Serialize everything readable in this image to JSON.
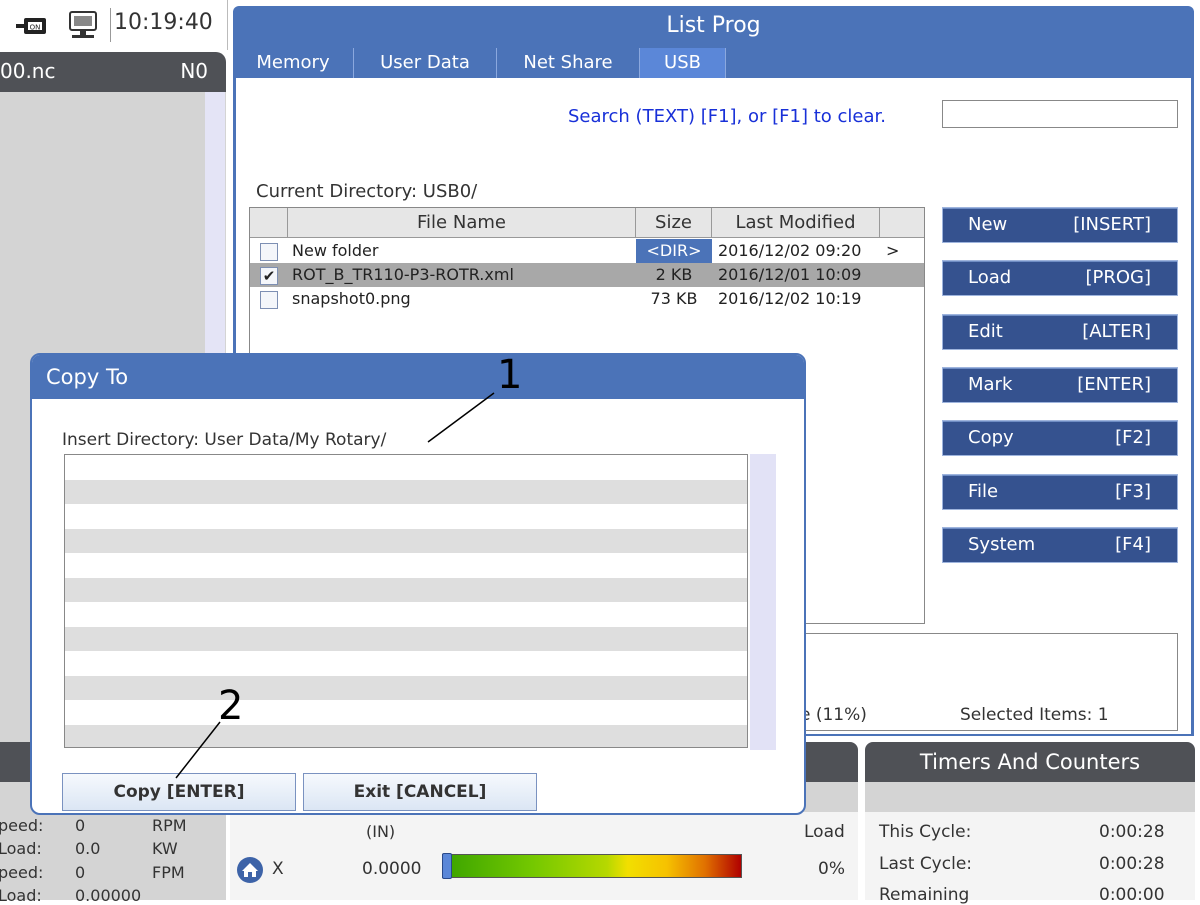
{
  "status": {
    "clock": "10:19:40"
  },
  "program_panel": {
    "filename": "00.nc",
    "n_code": "N0"
  },
  "list_prog": {
    "title": "List Prog",
    "tabs": [
      "Memory",
      "User Data",
      "Net Share",
      "USB"
    ],
    "active_tab": "USB",
    "search_hint": "Search (TEXT) [F1], or [F1] to clear.",
    "search_value": "",
    "current_directory": "Current Directory: USB0/",
    "columns": [
      "File Name",
      "Size",
      "Last Modified"
    ],
    "files": [
      {
        "checked": false,
        "name": "New folder",
        "size": "<DIR>",
        "modified": "2016/12/02 09:20",
        "arrow": ">"
      },
      {
        "checked": true,
        "name": "ROT_B_TR110-P3-ROTR.xml",
        "size": "2 KB",
        "modified": "2016/12/01 10:09",
        "arrow": ""
      },
      {
        "checked": false,
        "name": "snapshot0.png",
        "size": "73 KB",
        "modified": "2016/12/02 10:19",
        "arrow": ""
      }
    ],
    "buttons": [
      {
        "label": "New",
        "key": "[INSERT]"
      },
      {
        "label": "Load",
        "key": "[PROG]"
      },
      {
        "label": "Edit",
        "key": "[ALTER]"
      },
      {
        "label": "Mark",
        "key": "[ENTER]"
      },
      {
        "label": "Copy",
        "key": "[F2]"
      },
      {
        "label": "File",
        "key": "[F3]"
      },
      {
        "label": "System",
        "key": "[F4]"
      }
    ],
    "usage_text": "e (11%)",
    "selected_items": "Selected Items: 1"
  },
  "dialog": {
    "title": "Copy To",
    "insert_directory": "Insert Directory: User Data/My Rotary/",
    "copy_button": "Copy [ENTER]",
    "exit_button": "Exit [CANCEL]"
  },
  "callouts": {
    "one": "1",
    "two": "2"
  },
  "spindle": [
    {
      "label": "peed:",
      "value": "0",
      "unit": "RPM"
    },
    {
      "label": "Load:",
      "value": "0.0",
      "unit": "KW"
    },
    {
      "label": "peed:",
      "value": "0",
      "unit": "FPM"
    },
    {
      "label": "Load:",
      "value": "0.00000",
      "unit": ""
    }
  ],
  "axis": {
    "units": "(IN)",
    "load_header": "Load",
    "name": "X",
    "position": "0.0000",
    "load": "0%",
    "load_fraction": 0.0
  },
  "timers": {
    "title": "Timers And Counters",
    "rows": [
      {
        "label": "This Cycle:",
        "value": "0:00:28"
      },
      {
        "label": "Last Cycle:",
        "value": "0:00:28"
      },
      {
        "label": "Remaining",
        "value": "0:00:00"
      }
    ]
  }
}
